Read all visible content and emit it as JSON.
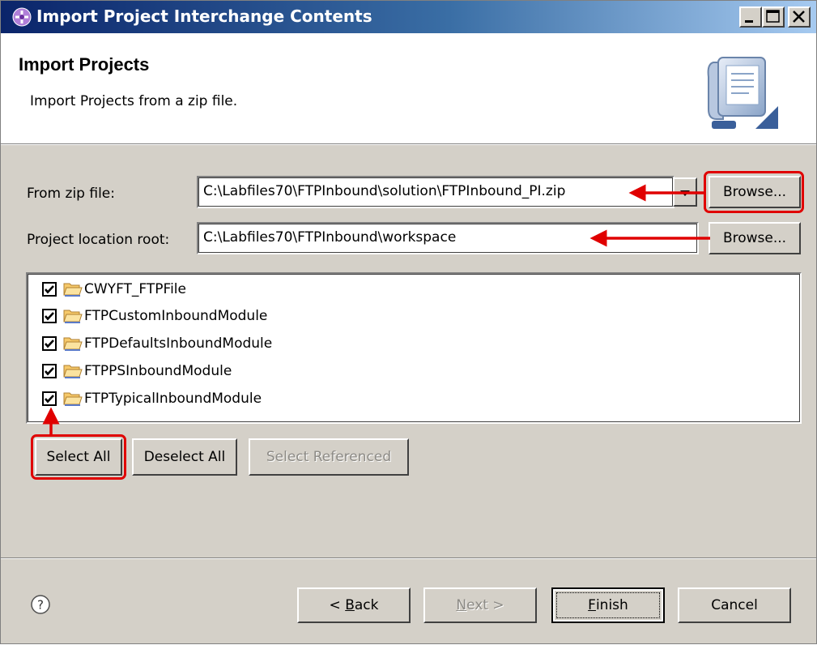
{
  "window": {
    "title": "Import Project Interchange Contents"
  },
  "header": {
    "title": "Import Projects",
    "description": "Import Projects from a zip file."
  },
  "from_zip": {
    "label": "From zip file:",
    "value": "C:\\Labfiles70\\FTPInbound\\solution\\FTPInbound_PI.zip",
    "browse_label": "Browse..."
  },
  "project_location": {
    "label": "Project location root:",
    "value": "C:\\Labfiles70\\FTPInbound\\workspace",
    "browse_label": "Browse..."
  },
  "projects": [
    {
      "name": "CWYFT_FTPFile",
      "checked": true
    },
    {
      "name": "FTPCustomInboundModule",
      "checked": true
    },
    {
      "name": "FTPDefaultsInboundModule",
      "checked": true
    },
    {
      "name": "FTPPSInboundModule",
      "checked": true
    },
    {
      "name": "FTPTypicalInboundModule",
      "checked": true
    }
  ],
  "selection_buttons": {
    "select_all": "Select All",
    "deselect_all": "Deselect All",
    "select_referenced": "Select Referenced"
  },
  "footer": {
    "back_prefix": "< ",
    "back_mnemonic": "B",
    "back_rest": "ack",
    "next_mnemonic": "N",
    "next_rest": "ext >",
    "finish_mnemonic": "F",
    "finish_rest": "inish",
    "cancel": "Cancel"
  },
  "colors": {
    "annotation": "#e00000",
    "title_gradient_start": "#0a246a",
    "title_gradient_end": "#a6caf0",
    "dialog_background": "#d4d0c8"
  },
  "icons": {
    "app": "websphere-integration-icon",
    "wizard": "import-wizard-banner-icon",
    "folder": "open-folder-icon",
    "help": "help-icon"
  }
}
